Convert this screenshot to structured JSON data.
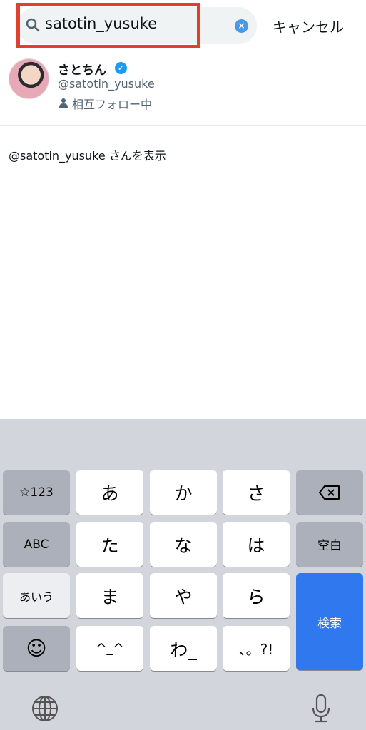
{
  "search": {
    "query": "satotin_yusuke",
    "cancel_label": "キャンセル"
  },
  "result": {
    "name": "さとちん",
    "handle": "@satotin_yusuke",
    "relation": "相互フォロー中",
    "verified": true
  },
  "view_user_label": "@satotin_yusuke さんを表示",
  "keyboard": {
    "keys": [
      "☆123",
      "あ",
      "か",
      "さ",
      "ABC",
      "た",
      "な",
      "は",
      "空白",
      "あいう",
      "ま",
      "や",
      "ら",
      "検索",
      "^_^",
      "わ_",
      "、。?!"
    ],
    "return_color": "#2f78ee"
  },
  "colors": {
    "highlight_box": "#e0412b",
    "accent": "#1d9bf0"
  }
}
